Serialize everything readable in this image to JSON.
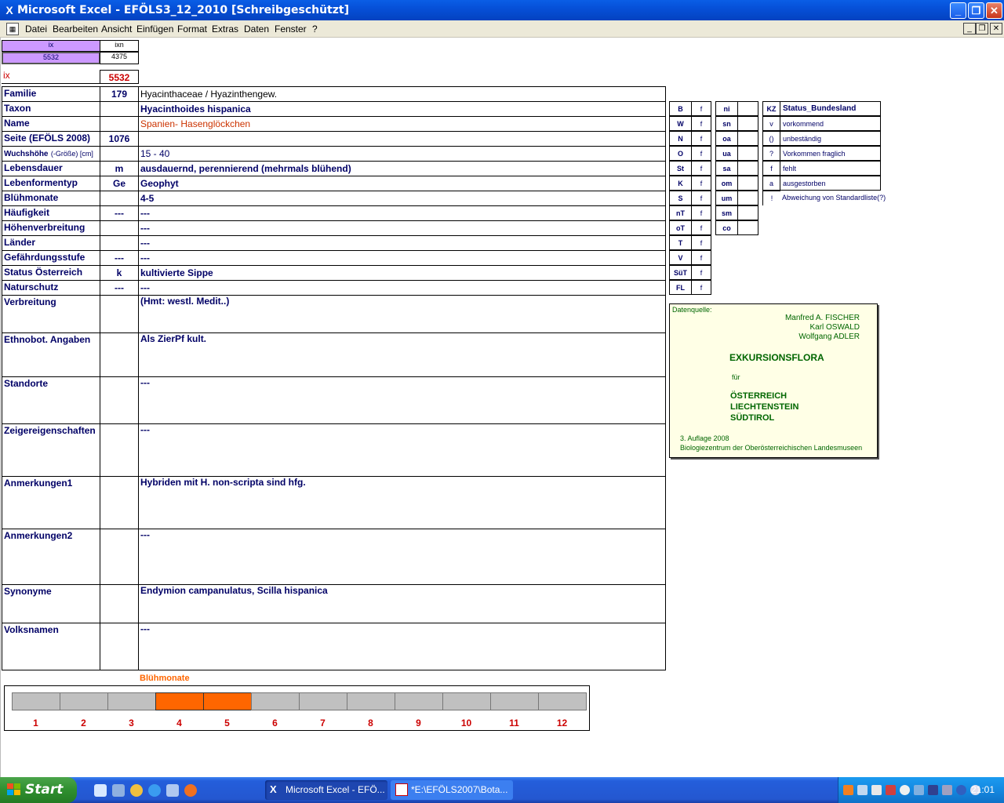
{
  "window": {
    "title": "Microsoft Excel - EFÖLS3_12_2010  [Schreibgeschützt]",
    "app_icon": "excel-icon",
    "controls": {
      "minimize": "_",
      "restore": "❐",
      "close": "✕"
    }
  },
  "menu": {
    "items": [
      "Datei",
      "Bearbeiten",
      "Ansicht",
      "Einfügen",
      "Format",
      "Extras",
      "Daten",
      "Fenster",
      "?"
    ],
    "mdi": {
      "minimize": "_",
      "restore": "❐",
      "close": "✕"
    }
  },
  "header_cells": {
    "ix_label": "ix",
    "ixn_label": "ixn",
    "ix_value": "5532",
    "ixn_value": "4375",
    "ix_row_label": "ix",
    "ix_row_value": "5532"
  },
  "fields": [
    {
      "label": "Familie",
      "code": "179",
      "value": "Hyacinthaceae  /  Hyazinthengew."
    },
    {
      "label": "Taxon",
      "code": "",
      "value": "Hyacinthoides hispanica"
    },
    {
      "label": "Name",
      "code": "",
      "value": "Spanien- Hasenglöckchen"
    },
    {
      "label": "Seite (EFÖLS 2008)",
      "code": "1076",
      "value": ""
    },
    {
      "label": "Wuchshöhe",
      "label_suffix": "(-Größe) [cm]",
      "code": "",
      "value": "15 - 40"
    },
    {
      "label": "Lebensdauer",
      "code": "m",
      "value": "ausdauernd, perennierend (mehrmals blühend)"
    },
    {
      "label": "Lebenformentyp",
      "code": "Ge",
      "value": "Geophyt"
    },
    {
      "label": "Blühmonate",
      "code": "",
      "value": "4-5"
    },
    {
      "label": "Häufigkeit",
      "code": "---",
      "value": "---"
    },
    {
      "label": "Höhenverbreitung",
      "code": "",
      "value": "---"
    },
    {
      "label": "Länder",
      "code": "",
      "value": "---"
    },
    {
      "label": "Gefährdungsstufe",
      "code": "---",
      "value": "---"
    },
    {
      "label": "Status Österreich",
      "code": "k",
      "value": "kultivierte Sippe"
    },
    {
      "label": "Naturschutz",
      "code": "---",
      "value": "---"
    },
    {
      "label": "Verbreitung",
      "code": "",
      "value": "(Hmt: westl. Medit..)"
    },
    {
      "label": "Ethnobot. Angaben",
      "code": "",
      "value": "Als ZierPf kult."
    },
    {
      "label": "Standorte",
      "code": "",
      "value": "---"
    },
    {
      "label": "Zeigereigenschaften",
      "code": "",
      "value": "---"
    },
    {
      "label": "Anmerkungen1",
      "code": "",
      "value": "Hybriden mit H. non-scripta sind hfg."
    },
    {
      "label": "Anmerkungen2",
      "code": "",
      "value": "---"
    },
    {
      "label": "Synonyme",
      "code": "",
      "value": "Endymion campanulatus, Scilla hispanica"
    },
    {
      "label": "Volksnamen",
      "code": "",
      "value": "---"
    }
  ],
  "legend_states": {
    "codes": [
      "B",
      "W",
      "N",
      "O",
      "St",
      "K",
      "S",
      "nT",
      "oT",
      "T",
      "V",
      "SüT",
      "FL"
    ],
    "status": "f"
  },
  "legend_regions": [
    "ni",
    "sn",
    "oa",
    "ua",
    "sa",
    "om",
    "um",
    "sm",
    "co"
  ],
  "legend_status": {
    "header": {
      "code": "KZ",
      "label": "Status_Bundesland"
    },
    "rows": [
      {
        "code": "v",
        "label": "vorkommend"
      },
      {
        "code": "()",
        "label": "unbeständig"
      },
      {
        "code": "?",
        "label": "Vorkommen fraglich"
      },
      {
        "code": "f",
        "label": "fehlt"
      },
      {
        "code": "a",
        "label": "ausgestorben"
      },
      {
        "code": "!",
        "label": "Abweichung von Standardliste(?)"
      }
    ]
  },
  "source": {
    "heading": "Datenquelle:",
    "authors": [
      "Manfred A. FISCHER",
      "Karl OSWALD",
      "Wolfgang ADLER"
    ],
    "book_title": "EXKURSIONSFLORA",
    "fuer": "für",
    "countries": [
      "ÖSTERREICH",
      "LIECHTENSTEIN",
      "SÜDTIROL"
    ],
    "edition": "3. Auflage 2008",
    "publisher": "Biologiezentrum der Oberösterreichischen Landesmuseen"
  },
  "chart_data": {
    "type": "bar",
    "title": "Blühmonate",
    "categories": [
      "1",
      "2",
      "3",
      "4",
      "5",
      "6",
      "7",
      "8",
      "9",
      "10",
      "11",
      "12"
    ],
    "values": [
      0,
      0,
      0,
      1,
      1,
      0,
      0,
      0,
      0,
      0,
      0,
      0
    ],
    "colors": {
      "on": "#ff6600",
      "off": "#c0c0c0"
    }
  },
  "taskbar": {
    "start": "Start",
    "tasks": [
      {
        "label": "Microsoft Excel - EFÖ...",
        "icon": "excel-icon"
      },
      {
        "label": "*E:\\EFÖLS2007\\Bota...",
        "icon": "document-icon"
      }
    ],
    "clock": "21:01"
  }
}
